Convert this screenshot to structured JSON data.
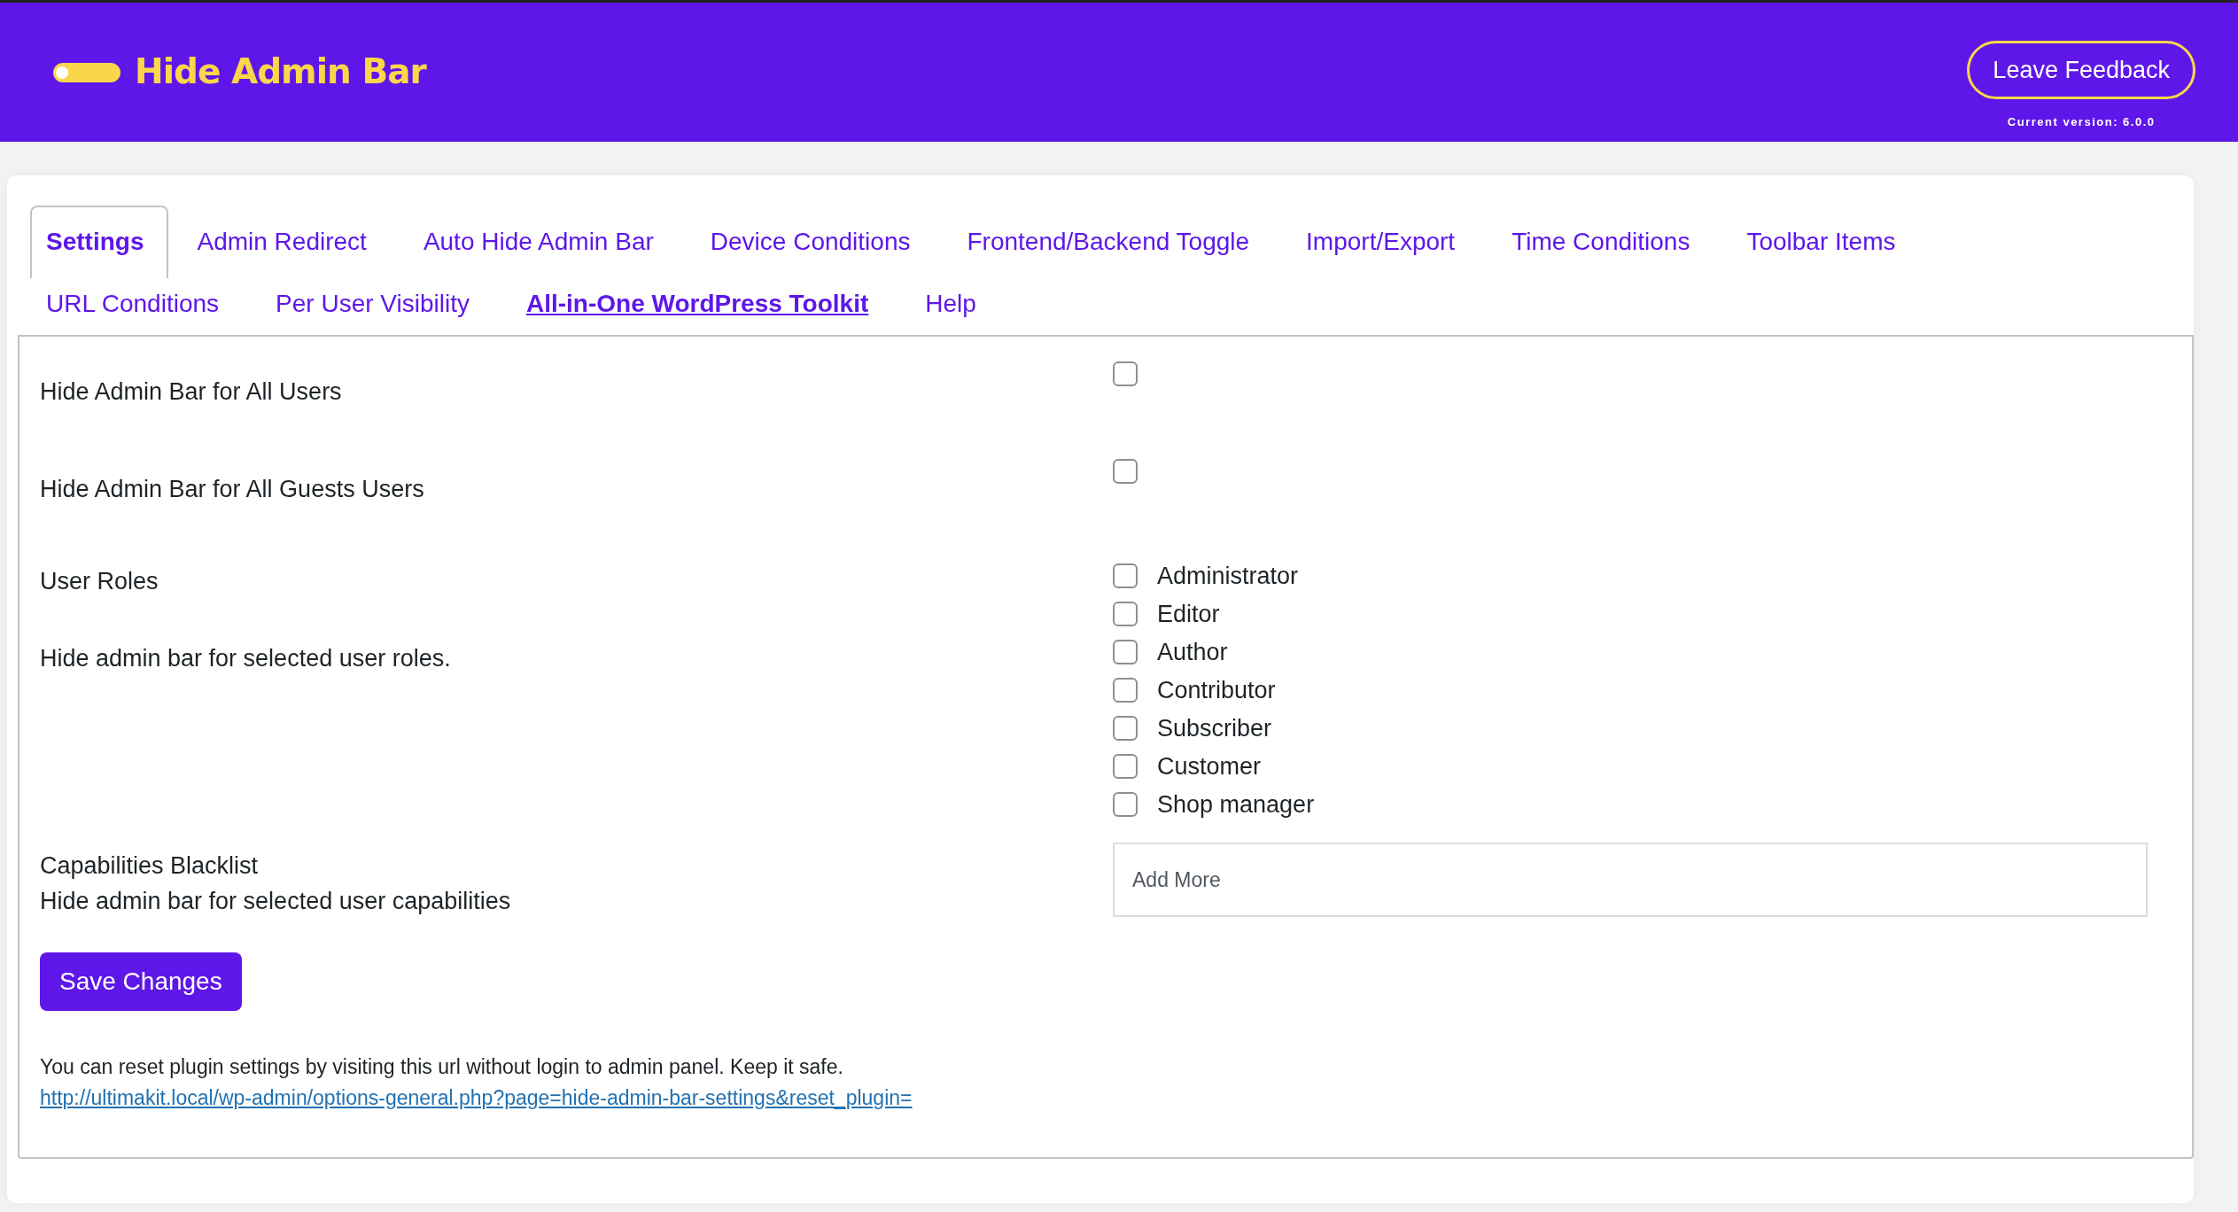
{
  "header": {
    "title": "Hide Admin Bar",
    "feedback_button": "Leave Feedback",
    "version": "Current version: 6.0.0"
  },
  "tab_rows": [
    [
      {
        "label": "Settings",
        "kind": "tab",
        "selected": true
      },
      {
        "label": "Admin Redirect",
        "kind": "tab",
        "selected": false
      },
      {
        "label": "Auto Hide Admin Bar",
        "kind": "tab",
        "selected": false
      },
      {
        "label": "Device Conditions",
        "kind": "tab",
        "selected": false
      },
      {
        "label": "Frontend/Backend Toggle",
        "kind": "tab",
        "selected": false
      },
      {
        "label": "Import/Export",
        "kind": "tab",
        "selected": false
      },
      {
        "label": "Time Conditions",
        "kind": "tab",
        "selected": false
      },
      {
        "label": "Toolbar Items",
        "kind": "tab",
        "selected": false
      }
    ],
    [
      {
        "label": "URL Conditions",
        "kind": "tab",
        "selected": false
      },
      {
        "label": "Per User Visibility",
        "kind": "tab",
        "selected": false
      },
      {
        "label": "All-in-One WordPress Toolkit",
        "kind": "promo",
        "selected": false
      },
      {
        "label": "Help",
        "kind": "tab",
        "selected": false
      }
    ]
  ],
  "settings": [
    {
      "kind": "checkbox",
      "label": "Hide Admin Bar for All Users",
      "checked": false
    },
    {
      "kind": "checkbox",
      "label": "Hide Admin Bar for All Guests Users",
      "checked": false
    },
    {
      "kind": "checklist",
      "label": "User Roles",
      "description": "Hide admin bar for selected user roles.",
      "options": [
        {
          "label": "Administrator",
          "checked": false
        },
        {
          "label": "Editor",
          "checked": false
        },
        {
          "label": "Author",
          "checked": false
        },
        {
          "label": "Contributor",
          "checked": false
        },
        {
          "label": "Subscriber",
          "checked": false
        },
        {
          "label": "Customer",
          "checked": false
        },
        {
          "label": "Shop manager",
          "checked": false
        }
      ]
    },
    {
      "kind": "tags",
      "label": "Capabilities Blacklist",
      "description": "Hide admin bar for selected user capabilities",
      "placeholder": "Add More"
    }
  ],
  "save_button": "Save Changes",
  "reset_note": "You can reset plugin settings by visiting this url without login to admin panel. Keep it safe.",
  "reset_link": "http://ultimakit.local/wp-admin/options-general.php?page=hide-admin-bar-settings&reset_plugin="
}
